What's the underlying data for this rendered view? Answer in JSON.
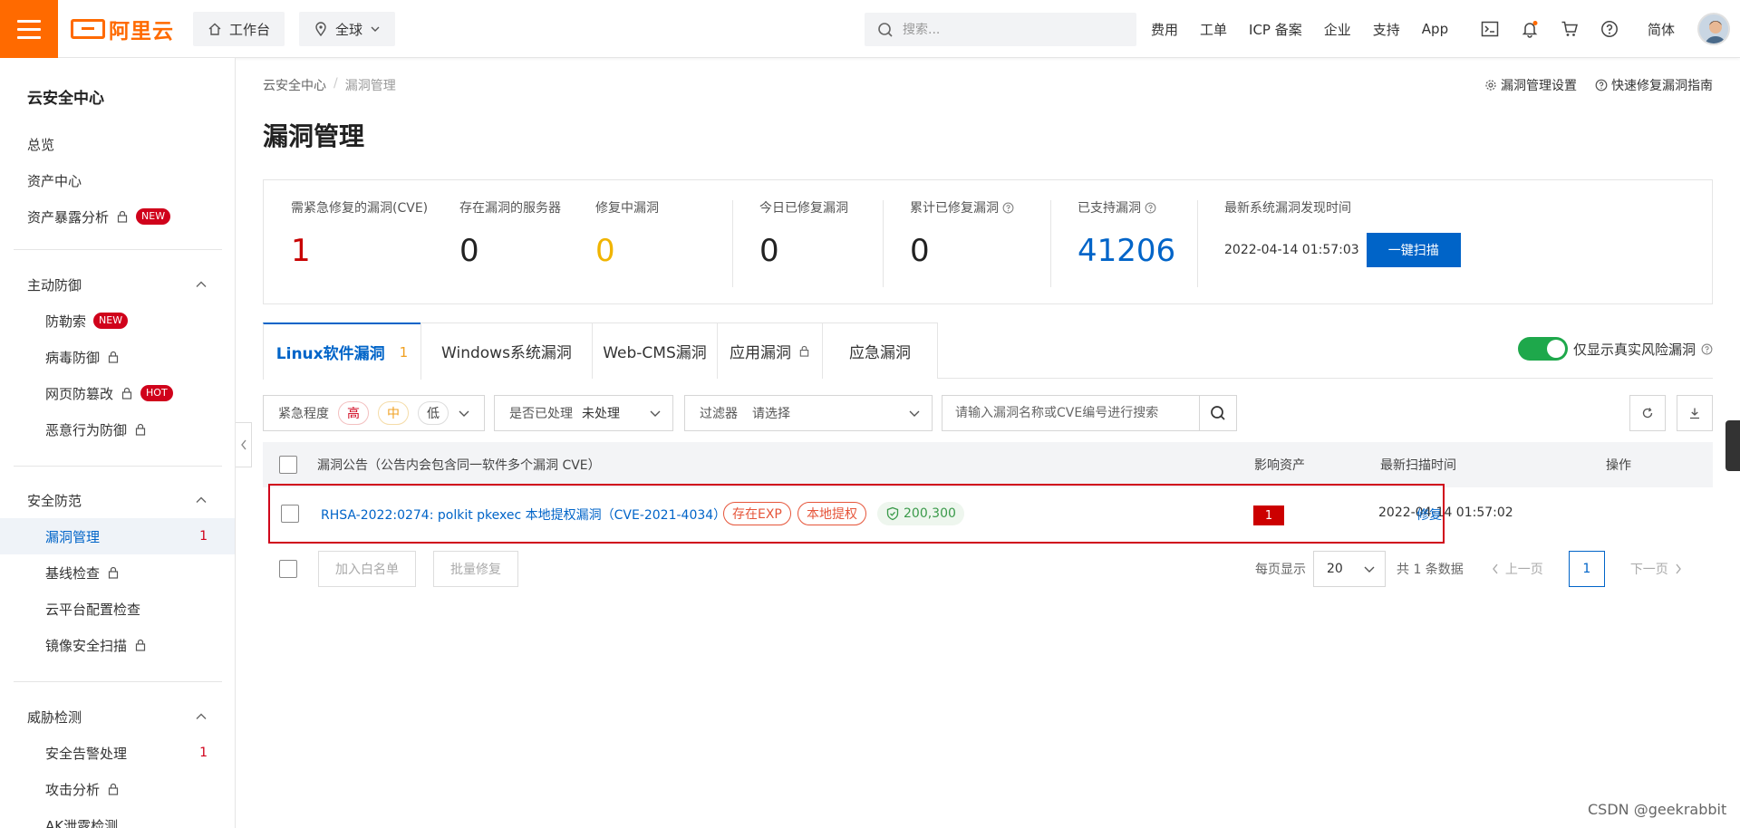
{
  "topbar": {
    "logo_text": "阿里云",
    "workbench": "工作台",
    "region": "全球",
    "search_placeholder": "搜索...",
    "links": [
      "费用",
      "工单",
      "ICP 备案",
      "企业",
      "支持",
      "App"
    ],
    "lang": "简体",
    "accent": "#ff6a00"
  },
  "sidebar": {
    "title": "云安全中心",
    "overview": "总览",
    "asset_center": "资产中心",
    "exposure": "资产暴露分析",
    "new_badge": "NEW",
    "hot_badge": "HOT",
    "group_active_defense": "主动防御",
    "ransomware": "防勒索",
    "virus": "病毒防御",
    "web_tamper": "网页防篡改",
    "malicious": "恶意行为防御",
    "group_security": "安全防范",
    "vuln_mgmt": "漏洞管理",
    "vuln_count": "1",
    "baseline": "基线检查",
    "cloud_config": "云平台配置检查",
    "image_scan": "镜像安全扫描",
    "group_threat": "威胁检测",
    "alert": "安全告警处理",
    "alert_count": "1",
    "attack": "攻击分析",
    "ak_leak": "AK泄露检测"
  },
  "breadcrumb": {
    "root": "云安全中心",
    "sep": "/",
    "current": "漏洞管理"
  },
  "top_actions": {
    "settings": "漏洞管理设置",
    "guide": "快速修复漏洞指南"
  },
  "page_title": "漏洞管理",
  "stats": {
    "urgent_label": "需紧急修复的漏洞(CVE)",
    "urgent_value": "1",
    "servers_label": "存在漏洞的服务器",
    "servers_value": "0",
    "fixing_label": "修复中漏洞",
    "fixing_value": "0",
    "today_label": "今日已修复漏洞",
    "today_value": "0",
    "total_label": "累计已修复漏洞",
    "total_value": "0",
    "supported_label": "已支持漏洞",
    "supported_value": "41206",
    "latest_label": "最新系统漏洞发现时间",
    "latest_time": "2022-04-14 01:57:03",
    "scan_button": "一键扫描"
  },
  "tabs": {
    "linux": "Linux软件漏洞",
    "linux_count": "1",
    "windows": "Windows系统漏洞",
    "webcms": "Web-CMS漏洞",
    "app": "应用漏洞",
    "emergency": "应急漏洞",
    "toggle_label": "仅显示真实风险漏洞"
  },
  "filters": {
    "urgency_label": "紧急程度",
    "high": "高",
    "mid": "中",
    "low": "低",
    "handled_label": "是否已处理",
    "handled_value": "未处理",
    "filter_label": "过滤器",
    "filter_value": "请选择",
    "search_placeholder": "请输入漏洞名称或CVE编号进行搜索"
  },
  "table": {
    "col_notice": "漏洞公告（公告内会包含同一软件多个漏洞 CVE）",
    "col_assets": "影响资产",
    "col_scan_time": "最新扫描时间",
    "col_action": "操作",
    "rows": [
      {
        "title": "RHSA-2022:0274: polkit pkexec 本地提权漏洞（CVE-2021-4034）",
        "tag1": "存在EXP",
        "tag2": "本地提权",
        "score": "200,300",
        "assets": "1",
        "time": "2022-04-14 01:57:02",
        "action": "修复"
      }
    ]
  },
  "footer": {
    "whitelist": "加入白名单",
    "batch_fix": "批量修复",
    "per_page_label": "每页显示",
    "per_page": "20",
    "total": "共 1 条数据",
    "prev": "上一页",
    "page": "1",
    "next": "下一页"
  },
  "watermark": "CSDN @geekrabbit"
}
